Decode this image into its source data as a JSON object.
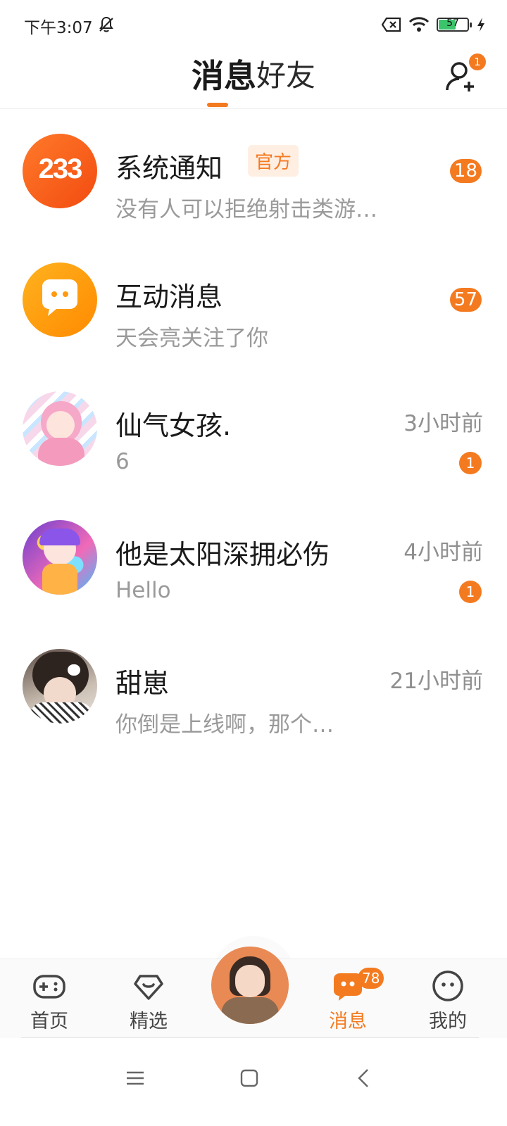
{
  "status": {
    "time": "下午3:07",
    "battery": "57"
  },
  "header": {
    "tab_messages": "消息",
    "tab_friends": "好友",
    "add_friend_badge": "1"
  },
  "conversations": [
    {
      "title": "系统通知",
      "tag": "官方",
      "preview": "没有人可以拒绝射击类游…",
      "badge": "18"
    },
    {
      "title": "互动消息",
      "preview": "天会亮关注了你",
      "badge": "57"
    },
    {
      "title": "仙气女孩.",
      "preview": "6",
      "time": "3小时前",
      "badge": "1"
    },
    {
      "title": "他是太阳深拥必伤",
      "preview": "Hello",
      "time": "4小时前",
      "badge": "1"
    },
    {
      "title": "甜崽",
      "preview": "你倒是上线啊，那个…",
      "time": "21小时前"
    }
  ],
  "avatar_texts": {
    "system": "233"
  },
  "nav": {
    "home": "首页",
    "featured": "精选",
    "messages": "消息",
    "messages_badge": "78",
    "mine": "我的"
  },
  "colors": {
    "accent": "#f47a20",
    "text_muted": "#9a9a9a"
  }
}
